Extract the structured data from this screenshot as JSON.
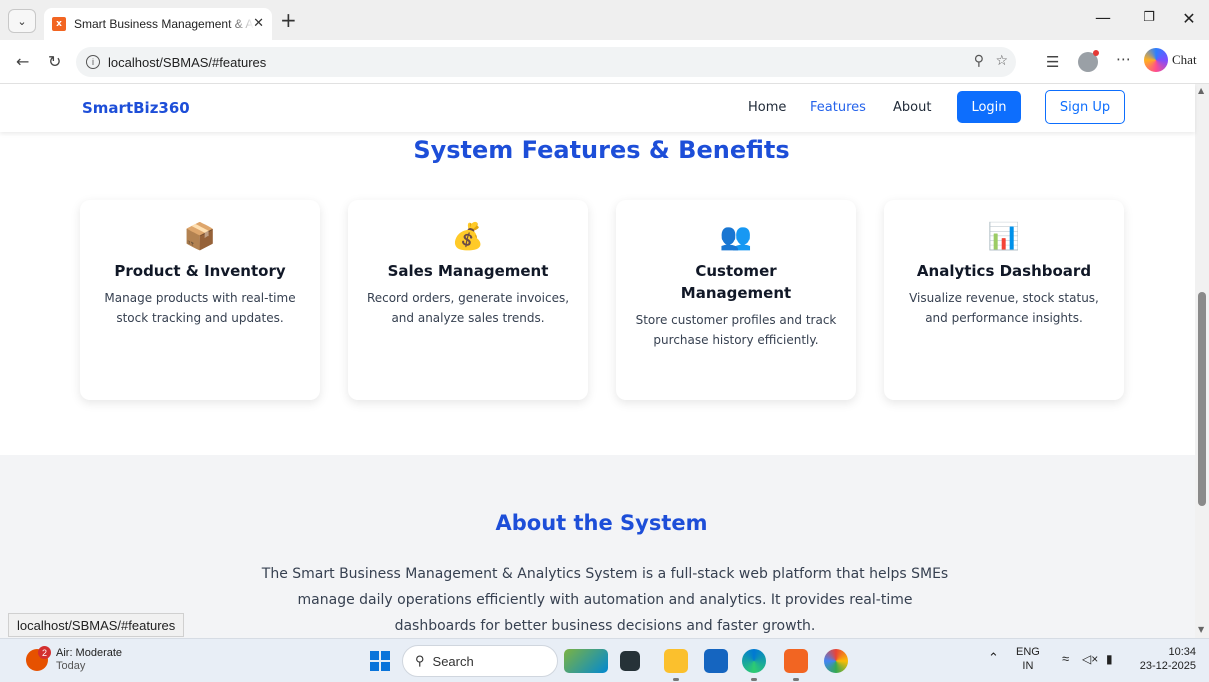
{
  "browser": {
    "tab_title": "Smart Business Management & Ar",
    "url": "localhost/SBMAS/#features",
    "chat_label": "Chat",
    "status_url": "localhost/SBMAS/#features"
  },
  "site": {
    "brand": "SmartBiz360",
    "nav": {
      "home": "Home",
      "features": "Features",
      "about": "About",
      "login": "Login",
      "signup": "Sign Up"
    },
    "features_title": "System Features & Benefits",
    "cards": [
      {
        "icon": "📦",
        "title": "Product & Inventory",
        "desc": "Manage products with real-time stock tracking and updates."
      },
      {
        "icon": "💰",
        "title": "Sales Management",
        "desc": "Record orders, generate invoices, and analyze sales trends."
      },
      {
        "icon": "👥",
        "title": "Customer Management",
        "desc": "Store customer profiles and track purchase history efficiently."
      },
      {
        "icon": "📊",
        "title": "Analytics Dashboard",
        "desc": "Visualize revenue, stock status, and performance insights."
      }
    ],
    "about_title": "About the System",
    "about_text": "The Smart Business Management & Analytics System is a full-stack web platform that helps SMEs manage daily operations efficiently with automation and analytics. It provides real-time dashboards for better business decisions and faster growth."
  },
  "taskbar": {
    "weather_badge": "2",
    "weather_title": "Air: Moderate",
    "weather_sub": "Today",
    "search_label": "Search",
    "lang_top": "ENG",
    "lang_bottom": "IN",
    "time": "10:34",
    "date": "23-12-2025"
  }
}
